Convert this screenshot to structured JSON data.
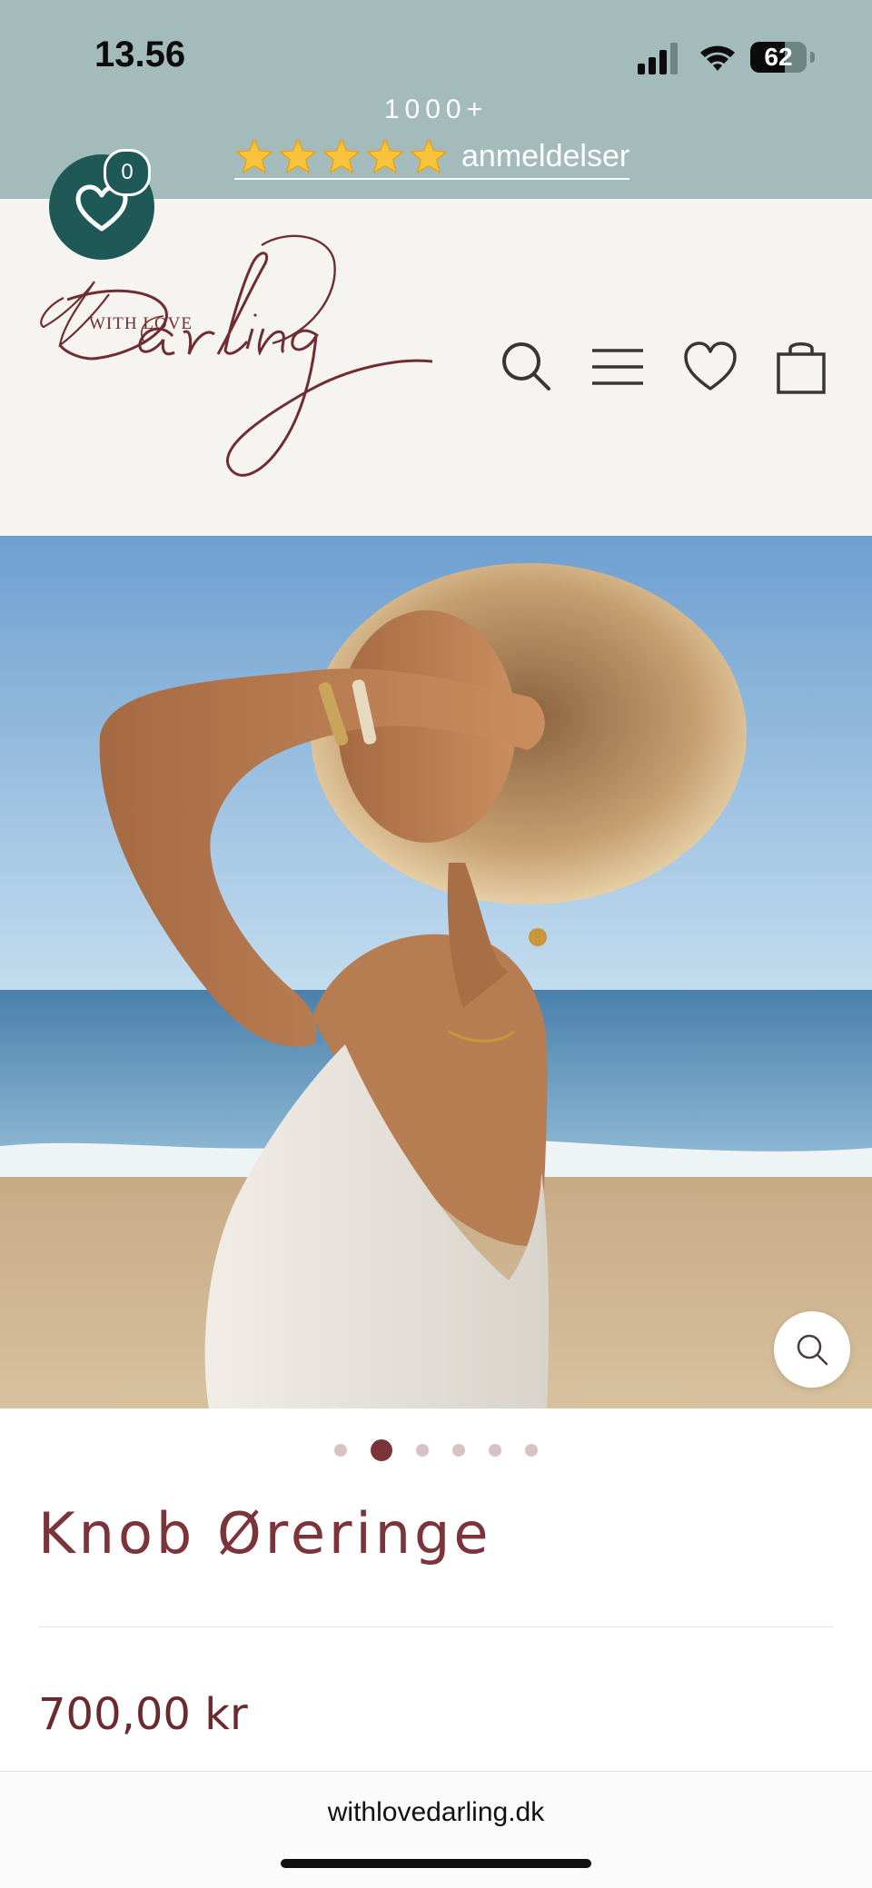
{
  "status_bar": {
    "time": "13.56",
    "battery": "62",
    "battery_level_percent": 62,
    "icons": [
      "signal-icon",
      "wifi-icon",
      "battery-icon"
    ]
  },
  "announcement": {
    "count": "1000+",
    "stars": 5,
    "link_text": "anmeldelser",
    "background_color": "#a3bbba",
    "icon": "star-icon"
  },
  "wishlist_badge": {
    "count": "0",
    "color": "#1f5957",
    "icon": "heart-icon"
  },
  "header": {
    "logo_small": "WITH LOVE",
    "logo_script": "Darling",
    "icons": [
      "search-icon",
      "menu-icon",
      "wishlist-icon",
      "cart-icon"
    ],
    "background_color": "#f6f4f1",
    "brand_color": "#6e2e31"
  },
  "gallery": {
    "dot_count": 6,
    "active_index": 1,
    "zoom_icon": "zoom-icon"
  },
  "product": {
    "title": "Knob Øreringe",
    "price": "700,00 kr",
    "title_color": "#7b3439"
  },
  "browser": {
    "url": "withlovedarling.dk"
  }
}
